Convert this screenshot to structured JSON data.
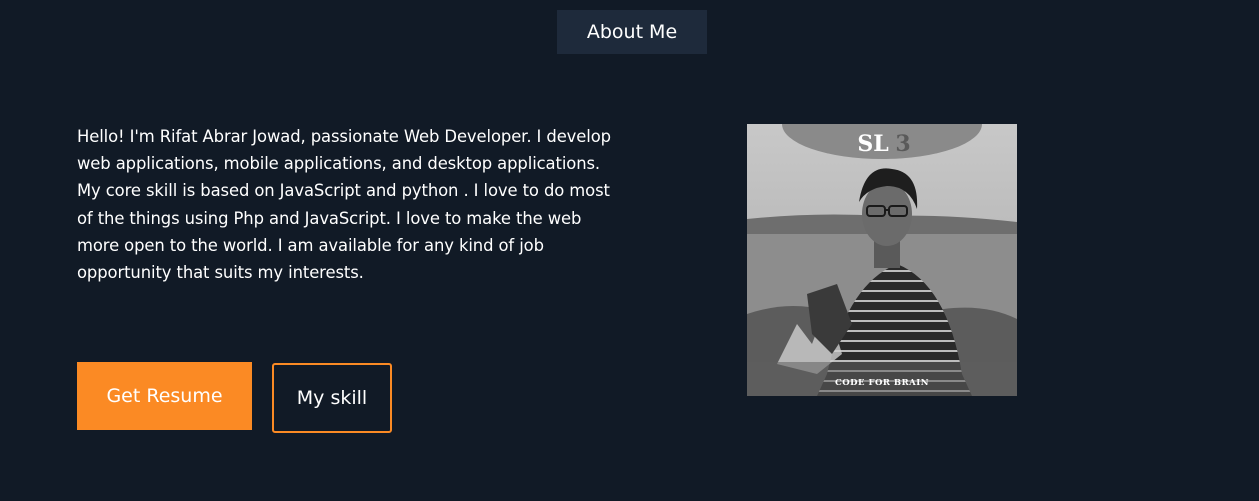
{
  "section": {
    "title": "About Me"
  },
  "about": {
    "text": "Hello! I'm Rifat Abrar Jowad, passionate Web Developer. I develop web applications, mobile applications, and desktop applications. My core skill is based on JavaScript and python . I love to do most of the things using Php and JavaScript. I love to make the web more open to the world. I am available for any kind of job opportunity that suits my interests."
  },
  "buttons": {
    "resume_label": "Get Resume",
    "skill_label": "My skill"
  },
  "photo": {
    "badge_text": "SL",
    "badge_number": "3",
    "caption": "CODE FOR BRAIN"
  },
  "colors": {
    "background": "#111a26",
    "title_bg": "#1e2a3b",
    "accent": "#fb8a24"
  }
}
